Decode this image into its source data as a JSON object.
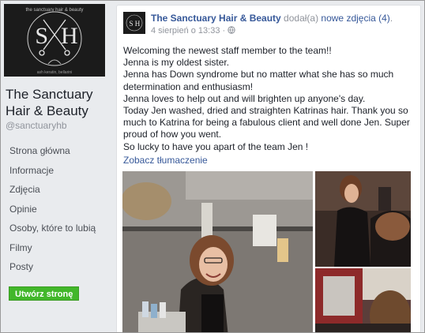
{
  "page": {
    "name": "The Sanctuary Hair & Beauty",
    "handle": "@sanctuaryhb"
  },
  "logo": {
    "text_top": "the sanctuary hair & beauty",
    "initials_left": "S",
    "initials_right": "H",
    "text_bottom": "ash keratin, bellarini"
  },
  "nav": {
    "items": [
      {
        "label": "Strona główna"
      },
      {
        "label": "Informacje"
      },
      {
        "label": "Zdjęcia"
      },
      {
        "label": "Opinie"
      },
      {
        "label": "Osoby, które to lubią"
      },
      {
        "label": "Filmy"
      },
      {
        "label": "Posty"
      }
    ],
    "create_button": "Utwórz stronę"
  },
  "post": {
    "author": "The Sanctuary Hair & Beauty",
    "action_prefix": " dodał(a) ",
    "action_link": "nowe zdjęcia (4)",
    "action_suffix": ".",
    "timestamp": "4 sierpień o 13:33",
    "lines": [
      "Welcoming the newest staff member to the team!!",
      "Jenna is my oldest sister.",
      "Jenna has Down syndrome but no matter what she has so much determination and enthusiasm!",
      "Jenna loves to help out and will brighten up anyone's day.",
      "Today Jen washed, dried and straighten Katrinas hair. Thank you so much to Katrina for being a fabulous client and well done Jen. Super proud of how you went.",
      "So lucky to have you apart of the team Jen !"
    ],
    "translate_link": "Zobacz tłumaczenie"
  },
  "colors": {
    "link": "#365899",
    "sidebar_bg": "#e9ebee",
    "button_green": "#42b72a",
    "logo_bg": "#1b1b1b"
  },
  "icons": {
    "privacy": "globe-icon"
  }
}
